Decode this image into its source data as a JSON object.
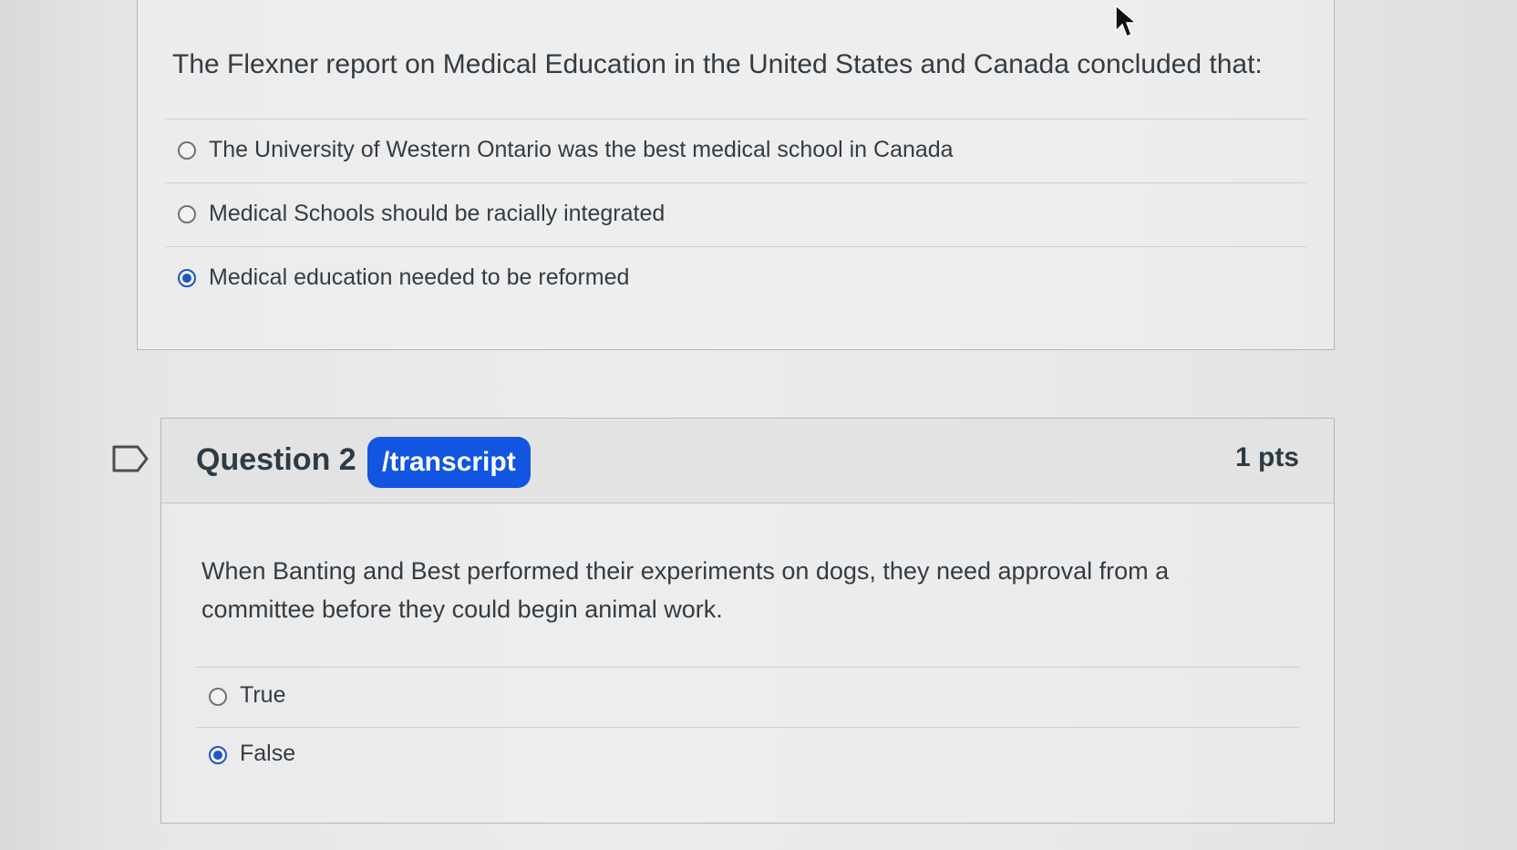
{
  "question1": {
    "text": "The Flexner report on Medical Education in the United States and Canada concluded that:",
    "answers": [
      {
        "label": "The University of Western Ontario was the best medical school in Canada",
        "selected": false
      },
      {
        "label": "Medical Schools should be racially integrated",
        "selected": false
      },
      {
        "label": "Medical education needed to be reformed",
        "selected": true
      }
    ]
  },
  "question2": {
    "title": "Question 2",
    "badge": "/transcript",
    "points": "1 pts",
    "text": "When Banting and Best performed their experiments on dogs, they need approval from a committee before they could begin animal work.",
    "answers": [
      {
        "label": "True",
        "selected": false
      },
      {
        "label": "False",
        "selected": true
      }
    ]
  },
  "colors": {
    "accent": "#1d57c7",
    "badge": "#1155e0",
    "text": "#333c44"
  },
  "icons": {
    "flag": "flag-bookmark-icon",
    "cursor": "mouse-pointer-icon"
  }
}
